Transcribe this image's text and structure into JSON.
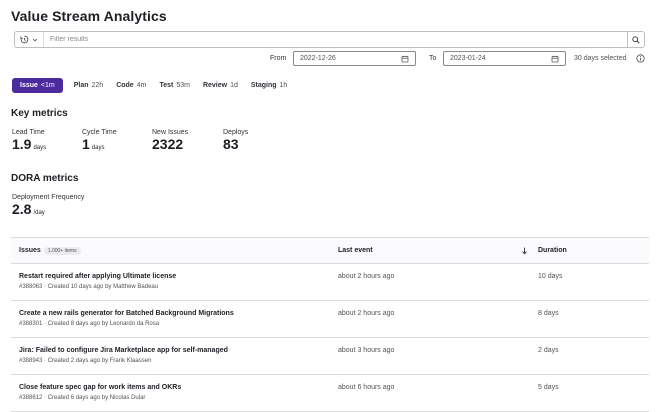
{
  "page": {
    "title": "Value Stream Analytics"
  },
  "filter": {
    "placeholder": "Filter results",
    "history_icon": "history-icon",
    "search_icon": "search-icon"
  },
  "daterange": {
    "from_label": "From",
    "from_value": "2022-12-26",
    "to_label": "To",
    "to_value": "2023-01-24",
    "selected_text": "30 days selected",
    "calendar_icon": "calendar-icon",
    "info_icon": "info-icon"
  },
  "stages": [
    {
      "name": "Issue",
      "value": "<1m",
      "active": true
    },
    {
      "name": "Plan",
      "value": "22h"
    },
    {
      "name": "Code",
      "value": "4m"
    },
    {
      "name": "Test",
      "value": "53m"
    },
    {
      "name": "Review",
      "value": "1d"
    },
    {
      "name": "Staging",
      "value": "1h"
    }
  ],
  "key_metrics": {
    "heading": "Key metrics",
    "items": [
      {
        "label": "Lead Time",
        "value": "1.9",
        "unit": "days"
      },
      {
        "label": "Cycle Time",
        "value": "1",
        "unit": "days"
      },
      {
        "label": "New Issues",
        "value": "2322",
        "unit": ""
      },
      {
        "label": "Deploys",
        "value": "83",
        "unit": ""
      }
    ]
  },
  "dora": {
    "heading": "DORA metrics",
    "items": [
      {
        "label": "Deployment Frequency",
        "value": "2.8",
        "unit": "/day"
      }
    ]
  },
  "table": {
    "col_issues": "Issues",
    "issues_badge": "1,000+ items",
    "col_last_event": "Last event",
    "sort_icon": "arrow-down-icon",
    "col_duration": "Duration",
    "rows": [
      {
        "title": "Restart required after applying Ultimate license",
        "sub": "#388063 · Created 10 days ago by Matthew Badeau",
        "last_event": "about 2 hours ago",
        "duration": "10 days"
      },
      {
        "title": "Create a new rails generator for Batched Background Migrations",
        "sub": "#388301 · Created 8 days ago by Leonardo da Rosa",
        "last_event": "about 2 hours ago",
        "duration": "8 days"
      },
      {
        "title": "Jira: Failed to configure Jira Marketplace app for self-managed",
        "sub": "#388943 · Created 2 days ago by Frank Klaassen",
        "last_event": "about 3 hours ago",
        "duration": "2 days"
      },
      {
        "title": "Close feature spec gap for work items and OKRs",
        "sub": "#388612 · Created 6 days ago by Nicolas Dular",
        "last_event": "about 6 hours ago",
        "duration": "5 days"
      }
    ]
  }
}
